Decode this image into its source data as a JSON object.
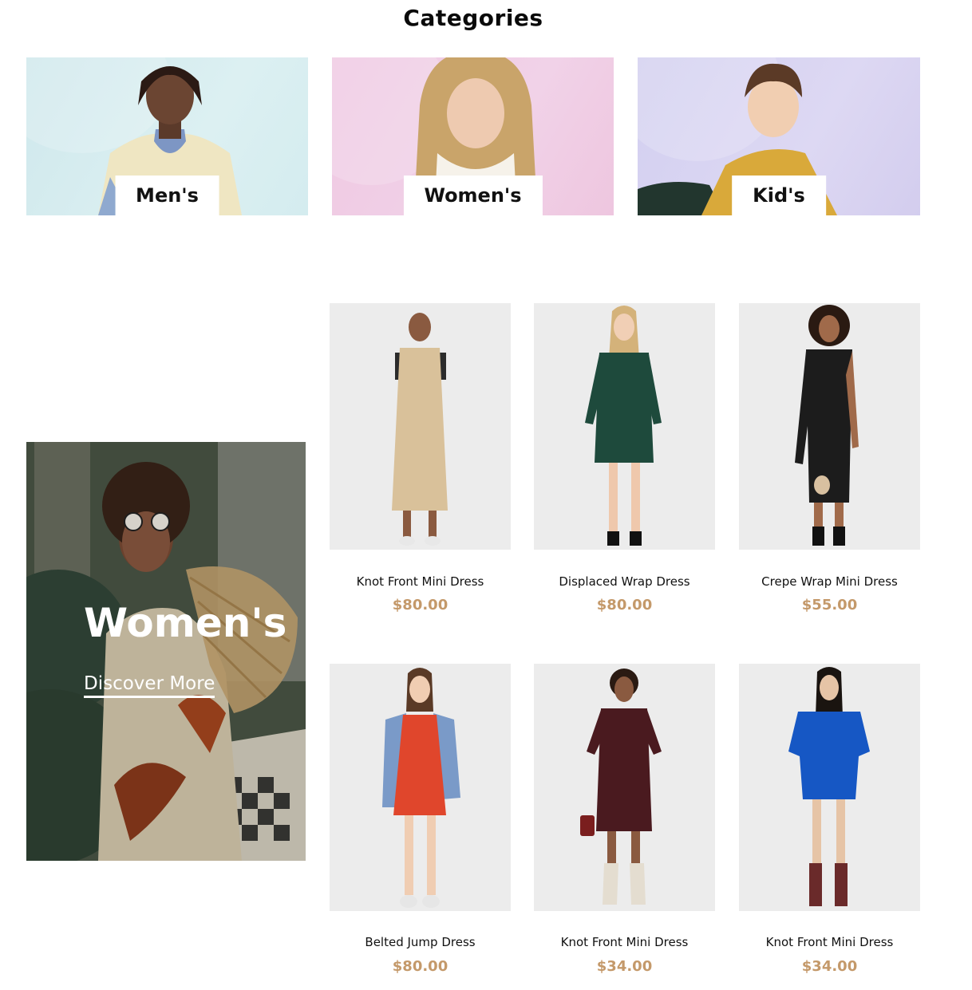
{
  "section_title": "Categories",
  "categories": [
    {
      "label": "Men's",
      "accent": "#d3ebee"
    },
    {
      "label": "Women's",
      "accent": "#efcce4"
    },
    {
      "label": "Kid's",
      "accent": "#d8d3f1"
    }
  ],
  "promo": {
    "title": "Women's",
    "link_label": "Discover More"
  },
  "products": [
    {
      "name": "Knot Front Mini Dress",
      "price": "$80.00",
      "dress_color": "#d9c19a"
    },
    {
      "name": "Displaced Wrap Dress",
      "price": "$80.00",
      "dress_color": "#1e4a3c"
    },
    {
      "name": "Crepe Wrap Mini Dress",
      "price": "$55.00",
      "dress_color": "#1c1c1c"
    },
    {
      "name": "Belted Jump Dress",
      "price": "$80.00",
      "dress_color": "#e0462c"
    },
    {
      "name": "Knot Front Mini Dress",
      "price": "$34.00",
      "dress_color": "#4a1a1f"
    },
    {
      "name": "Knot Front Mini Dress",
      "price": "$34.00",
      "dress_color": "#1657c4"
    }
  ],
  "colors": {
    "price": "#c4996a",
    "image_bg": "#ececec"
  }
}
